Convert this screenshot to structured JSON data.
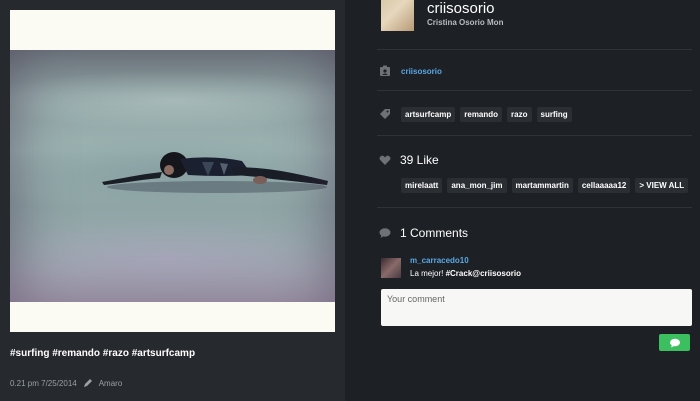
{
  "post": {
    "hashtags": "#surfing #remando #razo #artsurfcamp",
    "time": "0.21 pm 7/25/2014",
    "filter": "Amaro"
  },
  "profile": {
    "username": "criisosorio",
    "fullname": "Cristina Osorio Mon",
    "tagged_user": "criisosorio"
  },
  "tags": [
    "artsurfcamp",
    "remando",
    "razo",
    "surfing"
  ],
  "likes": {
    "title": "39 Like",
    "users": [
      "mirelaatt",
      "ana_mon_jim",
      "martammartin",
      "cellaaaaa12"
    ],
    "view_all": "> VIEW ALL"
  },
  "comments": {
    "title": "1 Comments",
    "items": [
      {
        "user": "m_carracedo10",
        "text_plain": "La mejor! ",
        "text_bold": "#Crack@criisosorio"
      }
    ],
    "input_placeholder": "Your comment"
  },
  "colors": {
    "link": "#5aa8e6",
    "send_button": "#3cbf5e",
    "panel_bg": "#1d2024",
    "left_bg": "#26292d"
  },
  "icons": {
    "owner": "id-badge-icon",
    "tags": "tag-icon",
    "likes": "heart-icon",
    "comments": "speech-bubble-icon",
    "edit": "pencil-icon",
    "send": "chat-bubble-icon"
  }
}
